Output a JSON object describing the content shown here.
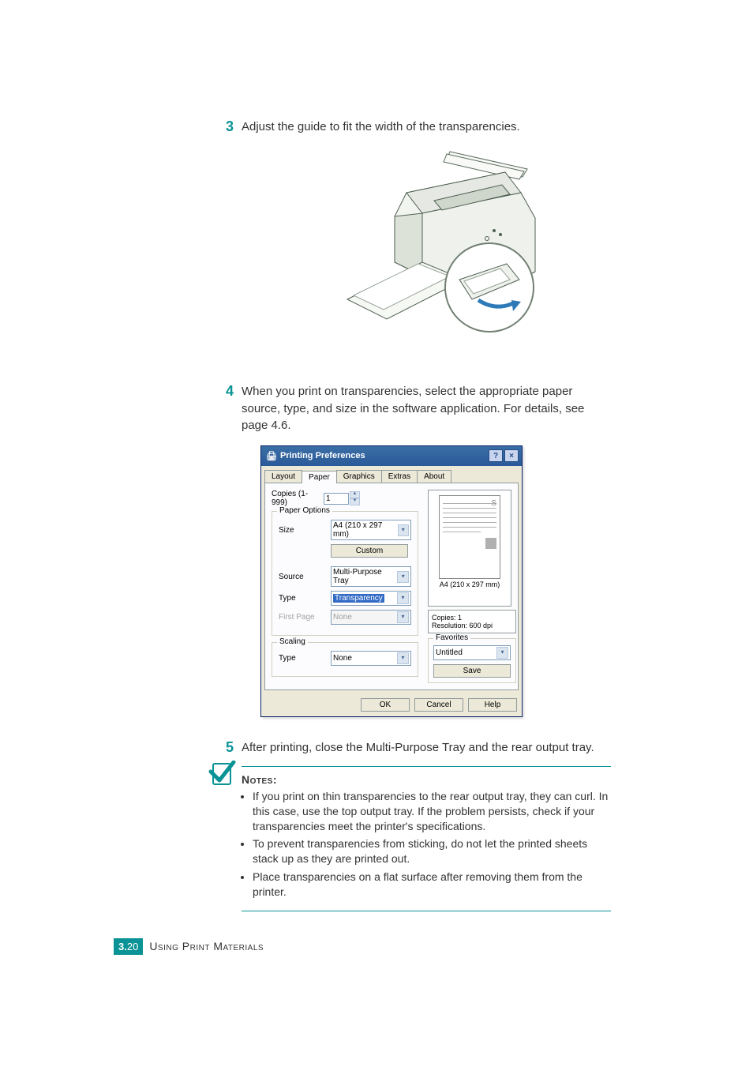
{
  "steps": {
    "s3": {
      "num": "3",
      "text": "Adjust the guide to fit the width of the transparencies."
    },
    "s4": {
      "num": "4",
      "text": "When you print on transparencies, select the appropriate paper source, type, and size in the software application. For details, see page 4.6."
    },
    "s5": {
      "num": "5",
      "text": "After printing, close the Multi-Purpose Tray and the rear output tray."
    }
  },
  "dialog": {
    "title": "Printing Preferences",
    "help_btn": "?",
    "close_btn": "×",
    "tabs": [
      "Layout",
      "Paper",
      "Graphics",
      "Extras",
      "About"
    ],
    "active_tab": 1,
    "copies_label": "Copies (1-999)",
    "copies_value": "1",
    "paper_options_group": "Paper Options",
    "size_label": "Size",
    "size_value": "A4 (210 x 297 mm)",
    "custom_btn": "Custom",
    "source_label": "Source",
    "source_value": "Multi-Purpose Tray",
    "type_label": "Type",
    "type_value": "Transparency",
    "firstpage_label": "First Page",
    "firstpage_value": "None",
    "scaling_group": "Scaling",
    "scaling_type_label": "Type",
    "scaling_type_value": "None",
    "preview_corner": "S",
    "preview_label": "A4 (210 x 297 mm)",
    "info_copies": "Copies: 1",
    "info_res": "Resolution: 600 dpi",
    "favorites_group": "Favorites",
    "favorites_value": "Untitled",
    "save_btn": "Save",
    "ok_btn": "OK",
    "cancel_btn": "Cancel",
    "help_text_btn": "Help"
  },
  "notes": {
    "heading": "Notes:",
    "items": [
      "If you print on thin transparencies to the rear output tray, they can curl. In this case, use the top output tray. If the problem persists, check if your transparencies meet the printer's specifications.",
      "To prevent transparencies from sticking, do not let the printed sheets stack up as they are printed out.",
      "Place transparencies on a flat surface after removing them from the printer."
    ]
  },
  "footer": {
    "chapter": "3.",
    "page": "20",
    "section_small": "Using Print Materials"
  }
}
